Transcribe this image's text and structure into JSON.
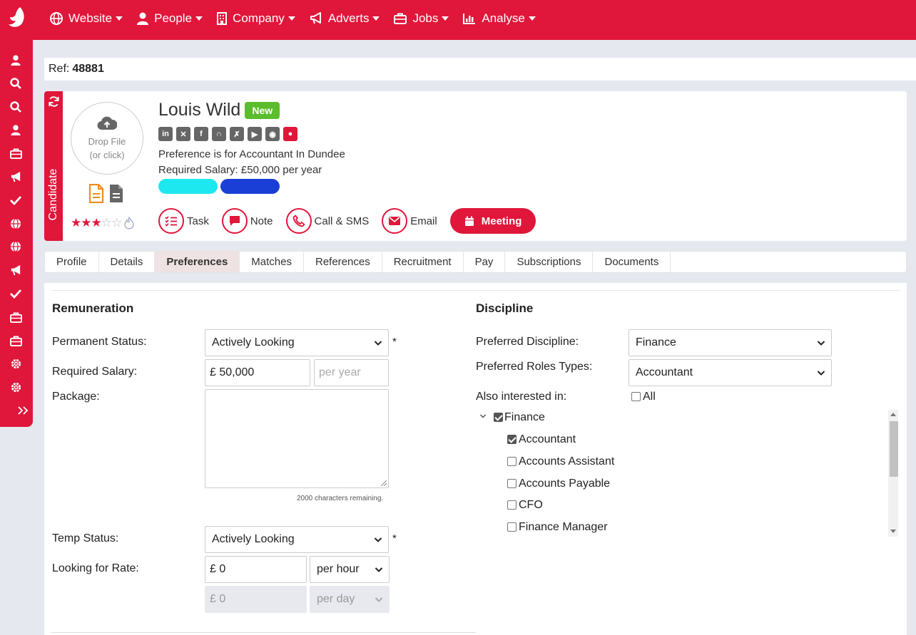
{
  "nav": {
    "items": [
      {
        "label": "Website",
        "icon": "globe-icon"
      },
      {
        "label": "People",
        "icon": "person-icon"
      },
      {
        "label": "Company",
        "icon": "building-icon"
      },
      {
        "label": "Adverts",
        "icon": "megaphone-icon"
      },
      {
        "label": "Jobs",
        "icon": "briefcase-icon"
      },
      {
        "label": "Analyse",
        "icon": "chart-icon"
      }
    ]
  },
  "ref": {
    "label": "Ref:",
    "value": "48881"
  },
  "candidate": {
    "tab_label": "Candidate",
    "dropzone_line1": "Drop File",
    "dropzone_line2": "(or click)",
    "name": "Louis Wild",
    "badge": "New",
    "preference_text": "Preference is for Accountant In Dundee",
    "salary_text": "Required Salary: £50,000 per year",
    "rating": 3,
    "rating_max": 5,
    "pill_colors": [
      "#1de8f0",
      "#1a3fd6"
    ]
  },
  "actions": {
    "task": "Task",
    "note": "Note",
    "call": "Call & SMS",
    "email": "Email",
    "meeting": "Meeting"
  },
  "tabs": [
    {
      "label": "Profile"
    },
    {
      "label": "Details"
    },
    {
      "label": "Preferences",
      "active": true
    },
    {
      "label": "Matches"
    },
    {
      "label": "References"
    },
    {
      "label": "Recruitment"
    },
    {
      "label": "Pay"
    },
    {
      "label": "Subscriptions"
    },
    {
      "label": "Documents"
    }
  ],
  "remuneration": {
    "heading": "Remuneration",
    "permanent_status_label": "Permanent Status:",
    "permanent_status_value": "Actively Looking",
    "required_salary_label": "Required Salary:",
    "required_salary_value": "£ 50,000",
    "salary_period_placeholder": "per year",
    "package_label": "Package:",
    "chars_remaining": "2000 characters remaining.",
    "temp_status_label": "Temp Status:",
    "temp_status_value": "Actively Looking",
    "rate_label": "Looking for Rate:",
    "rate_value": "£ 0",
    "rate_period": "per hour",
    "rate2_value": "£ 0",
    "rate2_period": "per day",
    "required_mark": "*"
  },
  "discipline": {
    "heading": "Discipline",
    "preferred_label": "Preferred Discipline:",
    "preferred_value": "Finance",
    "roles_label": "Preferred Roles Types:",
    "roles_value": "Accountant",
    "also_label": "Also interested in:",
    "all_label": "All",
    "tree_parent": "Finance",
    "tree_items": [
      {
        "label": "Accountant",
        "checked": true
      },
      {
        "label": "Accounts Assistant",
        "checked": false
      },
      {
        "label": "Accounts Payable",
        "checked": false
      },
      {
        "label": "CFO",
        "checked": false
      },
      {
        "label": "Finance Manager",
        "checked": false
      }
    ]
  },
  "colors": {
    "brand": "#e0163a",
    "badge_new": "#5bbd2b"
  }
}
